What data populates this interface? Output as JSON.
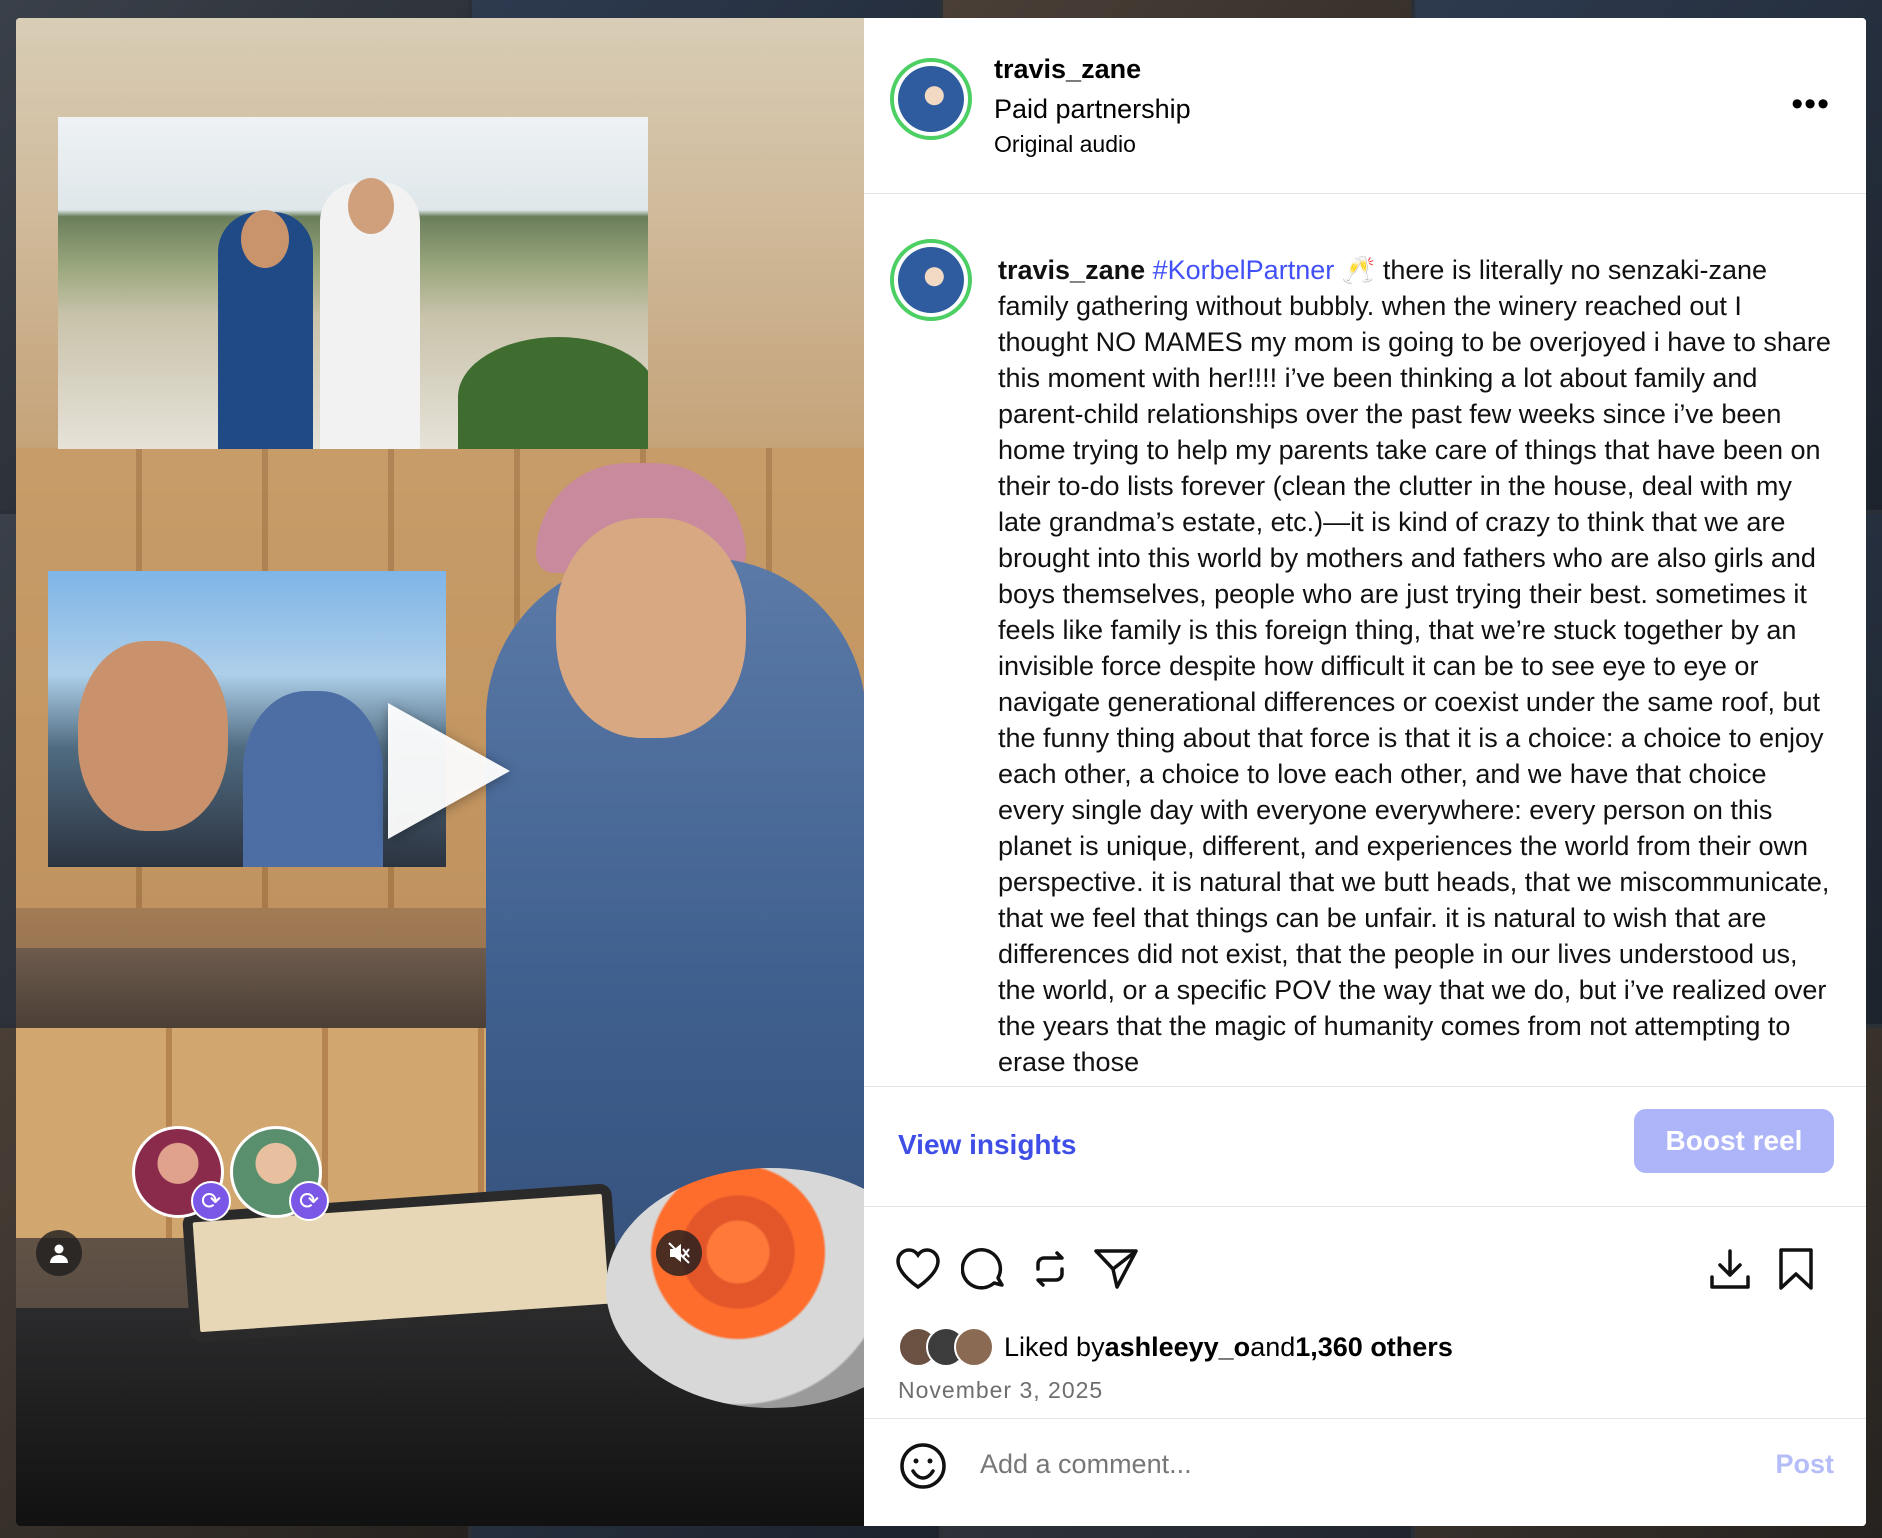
{
  "post": {
    "username": "travis_zane",
    "subtitle": "Paid partnership",
    "audio": "Original audio",
    "more_icon": "more-horizontal-icon"
  },
  "caption": {
    "username": "travis_zane",
    "hashtag": "#KorbelPartner",
    "text": " 🥂 there is literally no senzaki-zane family gathering without bubbly. when the winery reached out I thought NO MAMES my mom is going to be overjoyed i have to share this moment with her!!!! i’ve been thinking a lot about family and parent-child relationships over the past few weeks since i’ve been home trying to help my parents take care of things that have been on their to-do lists forever (clean the clutter in the house, deal with my late grandma’s estate, etc.)—it is kind of crazy to think that we are brought into this world by mothers and fathers who are also girls and boys themselves, people who are just trying their best. sometimes it feels like family is this foreign thing, that we’re stuck together by an invisible force despite how difficult it can be to see eye to eye or navigate generational differences or coexist under the same roof, but the funny thing about that force is that it is a choice: a choice to enjoy each other, a choice to love each other, and we have that choice every single day with everyone everywhere: every person on this planet is unique, different, and experiences the world from their own perspective. it is natural that we butt heads, that we miscommunicate, that we feel that things can be unfair. it is natural to wish that are differences did not exist, that the people in our lives understood us, the world, or a specific POV the way that we do, but i’ve realized over the years that the magic of humanity comes from not attempting to erase those"
  },
  "insights": {
    "view_label": "View insights",
    "boost_label": "Boost reel"
  },
  "engagement": {
    "liked_prefix": "Liked by ",
    "liked_user": "ashleeyy_o",
    "liked_and": " and ",
    "liked_count": "1,360 others",
    "date": "November 3, 2025"
  },
  "comment": {
    "placeholder": "Add a comment...",
    "post_label": "Post"
  },
  "colors": {
    "accent": "#4150f7",
    "boost_disabled": "#aeb4f8",
    "story_ring": "#4ccf63",
    "collab_badge": "#7b57e8"
  }
}
